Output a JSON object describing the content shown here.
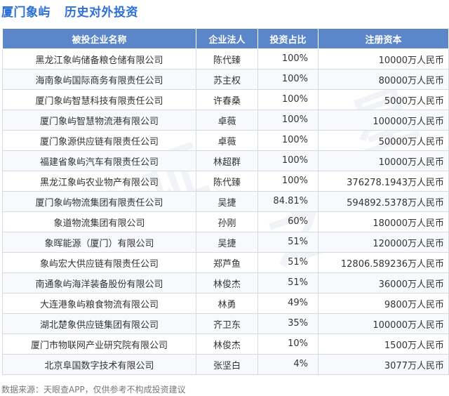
{
  "header": {
    "company": "厦门象屿",
    "subtitle": "历史对外投资"
  },
  "table": {
    "columns": [
      "被投企业名称",
      "企业法人",
      "投资占比",
      "注册资本"
    ],
    "rows": [
      {
        "name": "黑龙江象屿储备粮仓储有限公司",
        "rep": "陈代臻",
        "ratio": "100%",
        "capital": "10000万人民币"
      },
      {
        "name": "海南象屿国际商务有限责任公司",
        "rep": "苏主权",
        "ratio": "100%",
        "capital": "80000万人民币"
      },
      {
        "name": "厦门象屿智慧科技有限责任公司",
        "rep": "许春桑",
        "ratio": "100%",
        "capital": "5000万人民币"
      },
      {
        "name": "厦门象屿智慧物流港有限公司",
        "rep": "卓薇",
        "ratio": "100%",
        "capital": "100000万人民币"
      },
      {
        "name": "厦门象源供应链有限责任公司",
        "rep": "卓薇",
        "ratio": "100%",
        "capital": "50000万人民币"
      },
      {
        "name": "福建省象屿汽车有限责任公司",
        "rep": "林超群",
        "ratio": "100%",
        "capital": "10000万人民币"
      },
      {
        "name": "黑龙江象屿农业物产有限公司",
        "rep": "陈代臻",
        "ratio": "100%",
        "capital": "376278.1943万人民币"
      },
      {
        "name": "厦门象屿物流集团有限责任公司",
        "rep": "吴捷",
        "ratio": "84.81%",
        "capital": "594892.5378万人民币"
      },
      {
        "name": "象道物流集团有限公司",
        "rep": "孙刚",
        "ratio": "60%",
        "capital": "180000万人民币"
      },
      {
        "name": "象晖能源（厦门）有限公司",
        "rep": "吴捷",
        "ratio": "51%",
        "capital": "120000万人民币"
      },
      {
        "name": "象屿宏大供应链有限责任公司",
        "rep": "郑芦鱼",
        "ratio": "51%",
        "capital": "12806.589236万人民币"
      },
      {
        "name": "南通象屿海洋装备股份有限公司",
        "rep": "林俊杰",
        "ratio": "51%",
        "capital": "36000万人民币"
      },
      {
        "name": "大连港象屿粮食物流有限公司",
        "rep": "林勇",
        "ratio": "49%",
        "capital": "9800万人民币"
      },
      {
        "name": "湖北楚象供应链集团有限公司",
        "rep": "齐卫东",
        "ratio": "35%",
        "capital": "100000万人民币"
      },
      {
        "name": "厦门市物联网产业研究院有限公司",
        "rep": "林俊杰",
        "ratio": "10%",
        "capital": "1500万人民币"
      },
      {
        "name": "北京阜国数字技术有限公司",
        "rep": "张坚白",
        "ratio": "4%",
        "capital": "3077万人民币"
      }
    ]
  },
  "footer": {
    "source": "数据来源：天眼查APP，仅供参考不构成投资建议"
  },
  "watermark": {
    "text": "证之星"
  }
}
